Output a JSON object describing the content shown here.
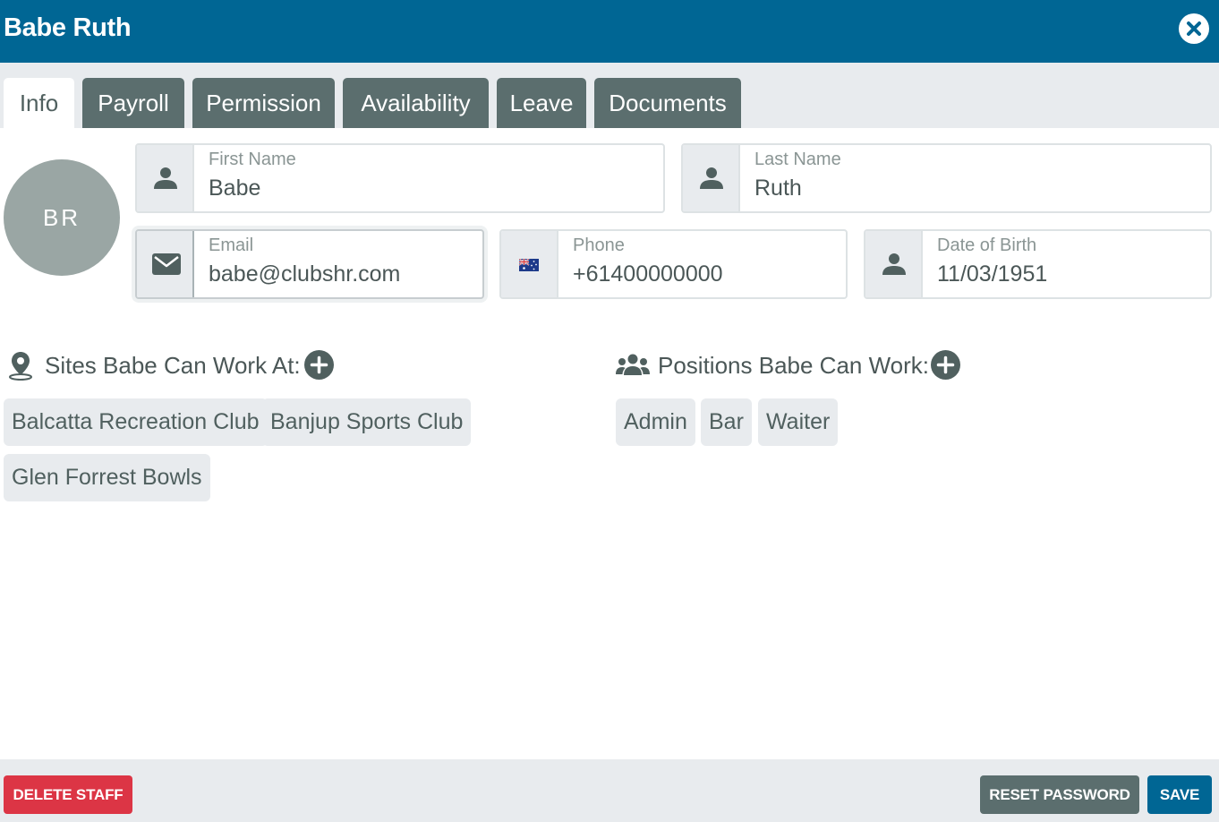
{
  "header": {
    "title": "Babe Ruth"
  },
  "tabs": [
    {
      "label": "Info",
      "active": true
    },
    {
      "label": "Payroll",
      "active": false
    },
    {
      "label": "Permission",
      "active": false
    },
    {
      "label": "Availability",
      "active": false
    },
    {
      "label": "Leave",
      "active": false
    },
    {
      "label": "Documents",
      "active": false
    }
  ],
  "avatar": {
    "initials": "BR"
  },
  "fields": {
    "first_name": {
      "label": "First Name",
      "value": "Babe",
      "icon": "person-icon"
    },
    "last_name": {
      "label": "Last Name",
      "value": "Ruth",
      "icon": "person-icon"
    },
    "email": {
      "label": "Email",
      "value": "babe@clubshr.com",
      "icon": "envelope-icon"
    },
    "phone": {
      "label": "Phone",
      "value": "+61400000000",
      "icon": "australia-flag-icon"
    },
    "dob": {
      "label": "Date of Birth",
      "value": "11/03/1951",
      "icon": "person-icon"
    }
  },
  "sites": {
    "title": "Sites Babe Can Work At:",
    "icon": "map-pin-icon",
    "items": [
      "Balcatta Recreation Club",
      "Banjup Sports Club",
      "Glen Forrest Bowls"
    ]
  },
  "positions": {
    "title": "Positions Babe Can Work:",
    "icon": "users-icon",
    "items": [
      "Admin",
      "Bar",
      "Waiter"
    ]
  },
  "footer": {
    "delete_label": "DELETE STAFF",
    "reset_label": "RESET PASSWORD",
    "save_label": "SAVE"
  },
  "colors": {
    "header": "#006694",
    "tab": "#5b6e6e",
    "danger": "#dc3545",
    "primary": "#006694",
    "avatar": "#9aa6a4"
  }
}
